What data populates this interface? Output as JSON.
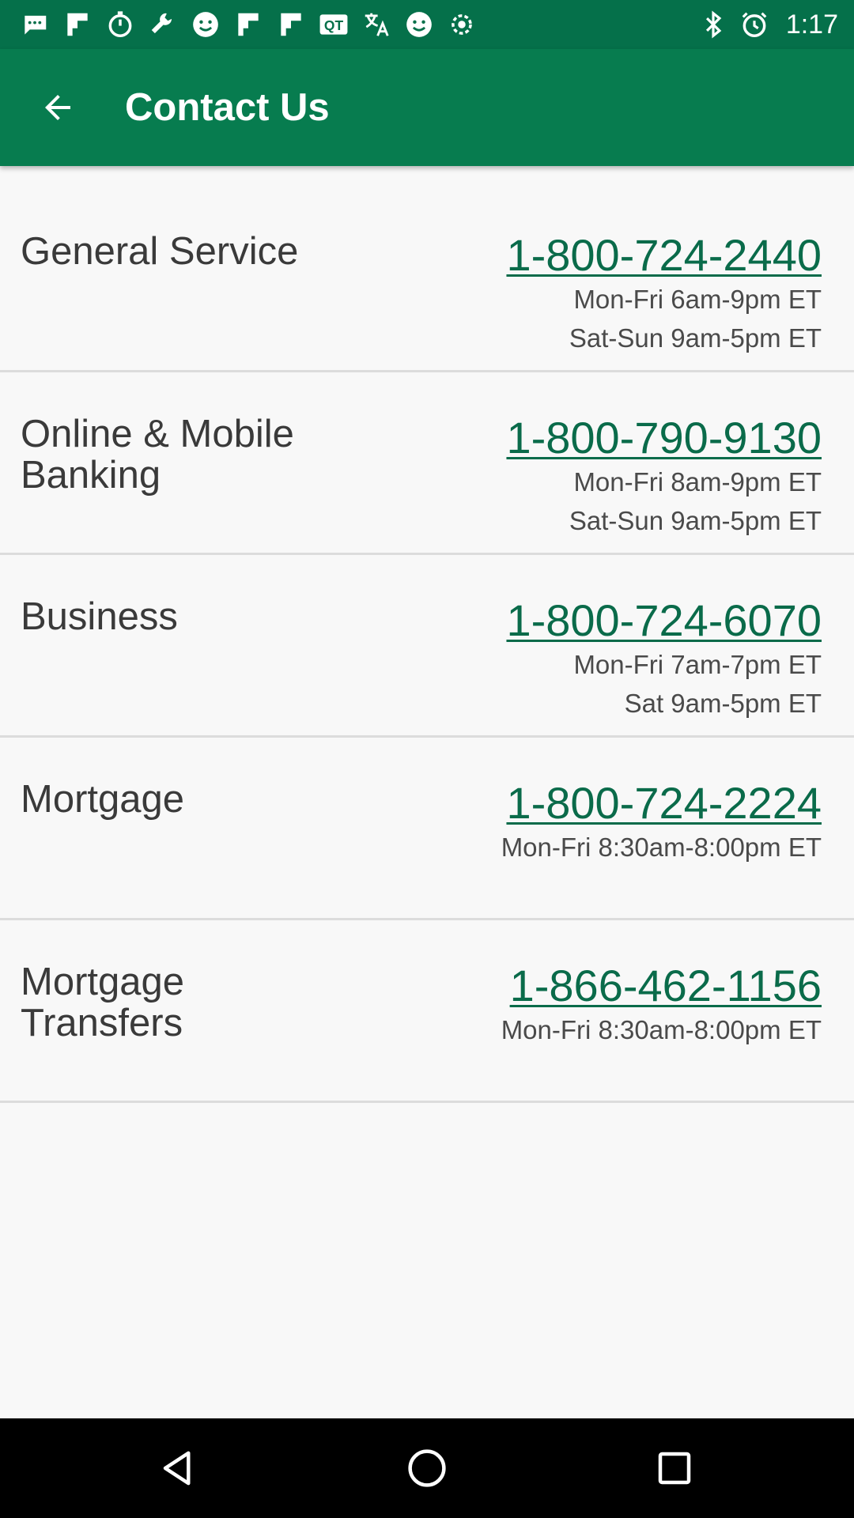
{
  "status_bar": {
    "time": "1:17",
    "icons": [
      "chat-icon",
      "flipboard-icon",
      "stopwatch-icon",
      "wrench-icon",
      "smiley-icon",
      "flipboard-icon",
      "flipboard-icon",
      "qt-icon",
      "translate-icon",
      "smiley-icon",
      "gear-icon",
      "bluetooth-icon",
      "alarm-icon"
    ],
    "qt_label": "QT"
  },
  "app_bar": {
    "title": "Contact Us",
    "back_icon": "arrow-back-icon",
    "color": "#077c4f"
  },
  "contacts": [
    {
      "label": "General Service",
      "phone": "1-800-724-2440",
      "hours": [
        "Mon-Fri 6am-9pm ET",
        "Sat-Sun 9am-5pm ET"
      ]
    },
    {
      "label": "Online & Mobile Banking",
      "phone": "1-800-790-9130",
      "hours": [
        "Mon-Fri 8am-9pm ET",
        "Sat-Sun 9am-5pm ET"
      ]
    },
    {
      "label": "Business",
      "phone": "1-800-724-6070",
      "hours": [
        "Mon-Fri 7am-7pm ET",
        "Sat 9am-5pm ET"
      ]
    },
    {
      "label": "Mortgage",
      "phone": "1-800-724-2224",
      "hours": [
        "Mon-Fri 8:30am-8:00pm ET"
      ]
    },
    {
      "label": "Mortgage Transfers",
      "phone": "1-866-462-1156",
      "hours": [
        "Mon-Fri 8:30am-8:00pm ET"
      ]
    }
  ],
  "colors": {
    "accent": "#077c4f",
    "phone_link": "#0a6b4a",
    "background": "#f8f8f8"
  },
  "nav_bar": {
    "buttons": [
      "back-triangle-icon",
      "home-circle-icon",
      "recents-square-icon"
    ]
  }
}
